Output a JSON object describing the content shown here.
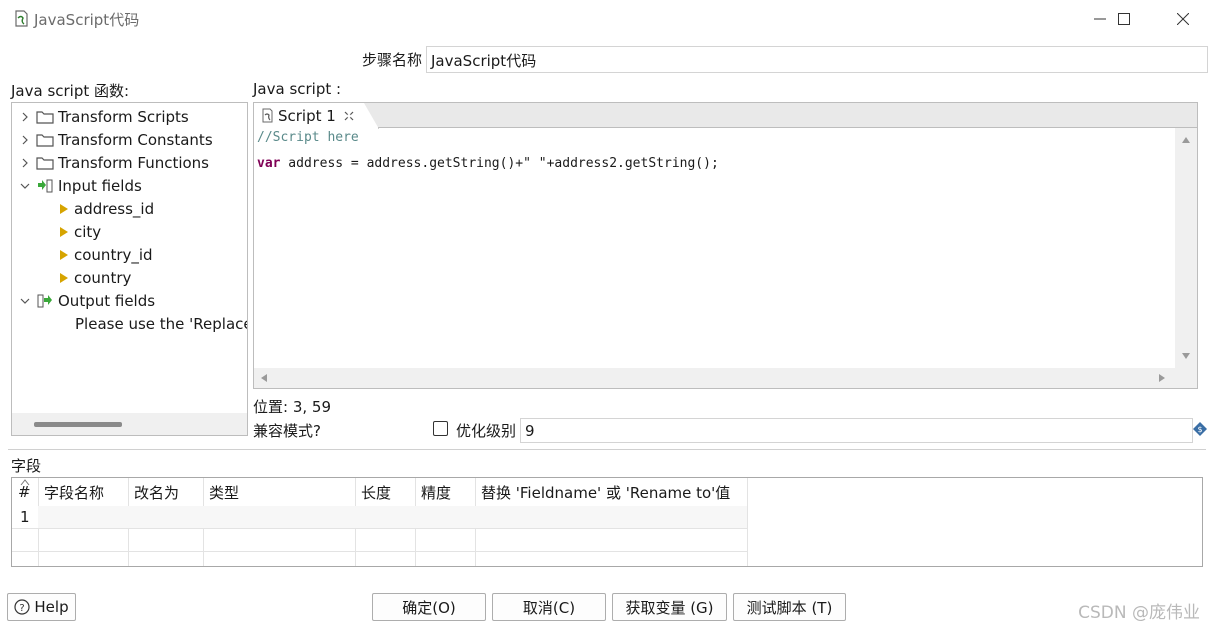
{
  "window": {
    "title": "JavaScript代码",
    "icons": [
      "app-icon",
      "minimize-icon",
      "maximize-icon",
      "close-icon"
    ]
  },
  "step": {
    "label": "步骤名称",
    "value": "JavaScript代码"
  },
  "functions_panel": {
    "label": "Java script 函数:",
    "tree": [
      {
        "label": "Transform Scripts",
        "icon": "folder-icon",
        "expanded": false
      },
      {
        "label": "Transform Constants",
        "icon": "folder-icon",
        "expanded": false
      },
      {
        "label": "Transform Functions",
        "icon": "folder-icon",
        "expanded": false
      },
      {
        "label": "Input fields",
        "icon": "input-fields-icon",
        "expanded": true,
        "children": [
          "address_id",
          "city",
          "country_id",
          "country"
        ]
      },
      {
        "label": "Output fields",
        "icon": "output-fields-icon",
        "expanded": true,
        "children": [
          "Please use the 'Replace"
        ]
      }
    ]
  },
  "script_panel": {
    "label": "Java script :",
    "tab_label": "Script 1",
    "code_comment": "//Script here",
    "code_keyword": "var",
    "code_rest": " address = address.getString()+\" \"+address2.getString();",
    "position_text": "位置: 3, 59"
  },
  "options": {
    "compat_label": "兼容模式?",
    "opt_label": "优化级别",
    "opt_value": "9"
  },
  "fields": {
    "section_label": "字段",
    "columns": [
      "#",
      "字段名称",
      "改名为",
      "类型",
      "长度",
      "精度",
      "替换 'Fieldname' 或 'Rename to'值"
    ],
    "rows": [
      [
        "1",
        "",
        "",
        "",
        "",
        "",
        ""
      ]
    ]
  },
  "buttons": {
    "help": "Help",
    "ok": "确定(O)",
    "cancel": "取消(C)",
    "get_vars": "获取变量 (G)",
    "test": "测试脚本 (T)"
  },
  "watermark": "CSDN @庞伟业"
}
